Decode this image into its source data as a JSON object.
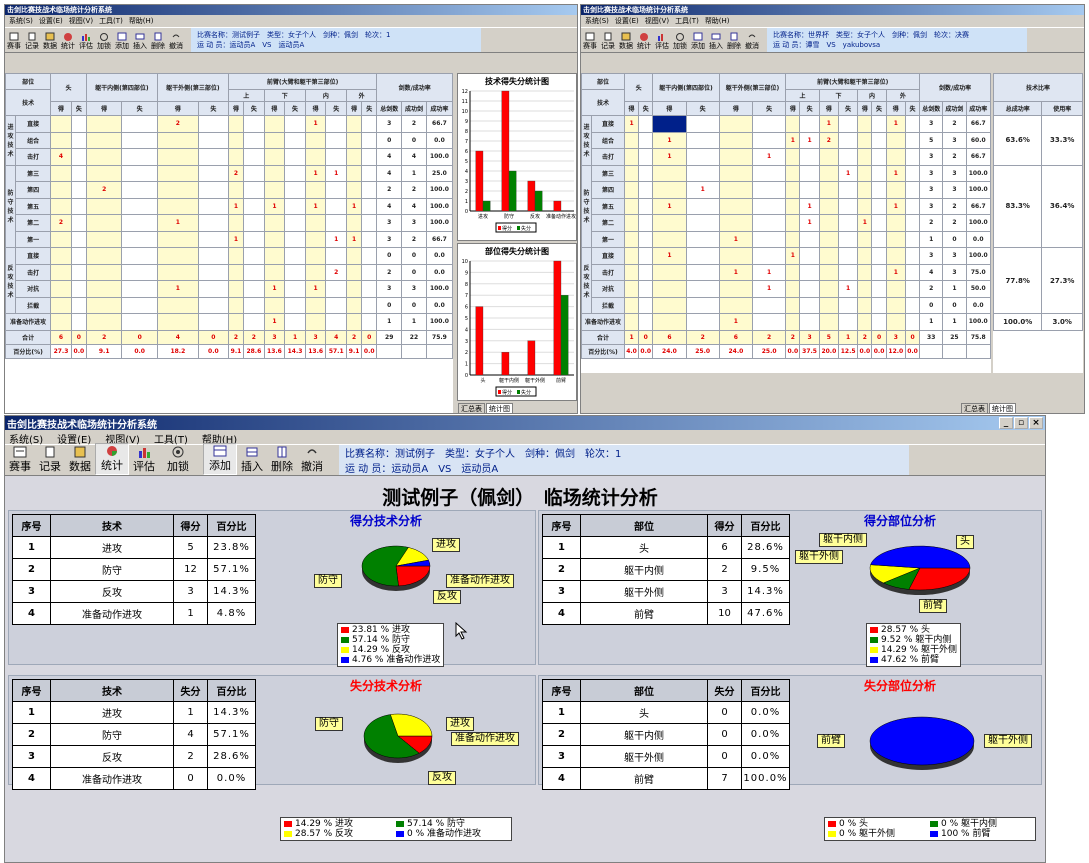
{
  "app_title": "击剑比赛技战术临场统计分析系统",
  "menu": [
    "系统(S)",
    "设置(E)",
    "视图(V)",
    "工具(T)",
    "帮助(H)"
  ],
  "toolbar": [
    "赛事",
    "记录",
    "数据",
    "统计",
    "评估",
    "加锁",
    "添加",
    "插入",
    "删除",
    "撤消"
  ],
  "match": {
    "line1": "比赛名称：测试例子　类型：女子个人　剑种：佩剑　轮次：1",
    "line2": "运 动 员：运动员A　VS　运动员A"
  },
  "right_match": {
    "line1": "比赛名称：世界杯　类型：女子个人　剑种：佩剑　轮次：决赛",
    "line2": "运 动 员：谭雪　VS　yakubovsa"
  },
  "title": "测试例子（佩剑）　临场统计分析",
  "grid_left": {
    "headers": {
      "part": "部位",
      "tech": "技术",
      "head": "头",
      "ti": "躯干内侧(第四部位)",
      "to": "躯干外侧(第三部位)",
      "arm": "前臂(大臂和躯干第三部位)",
      "up": "上",
      "down": "下",
      "in": "内",
      "out": "外",
      "rate": "剑数/成功率",
      "de": "得",
      "shi": "失",
      "total": "总剑数",
      "succ": "成功剑",
      "pct": "成功率"
    },
    "groups": [
      {
        "name": "进攻技术",
        "rows": [
          "直接",
          "组合",
          "击打"
        ]
      },
      {
        "name": "防守技术",
        "rows": [
          "第三",
          "第四",
          "第五",
          "第二",
          "第一"
        ]
      },
      {
        "name": "反攻技术",
        "rows": [
          "直接",
          "击打",
          "对抗",
          "拦截"
        ]
      },
      {
        "name": "",
        "rows": [
          "准备动作进攻"
        ]
      }
    ],
    "cells": [
      [
        "",
        "",
        "",
        "",
        "2",
        "",
        "",
        "",
        "",
        "",
        "1",
        "",
        "",
        "",
        ""
      ],
      [
        "",
        "",
        "",
        "",
        "",
        "",
        "",
        "",
        "",
        "",
        "",
        "",
        "",
        "",
        ""
      ],
      [
        "4",
        "",
        "",
        "",
        "",
        "",
        "",
        "",
        "",
        "",
        "",
        "",
        "",
        "",
        ""
      ],
      [
        "",
        "",
        "",
        "",
        "",
        "",
        "2",
        "",
        "",
        "",
        "1",
        "1",
        "",
        "",
        ""
      ],
      [
        "",
        "",
        "2",
        "",
        "",
        "",
        "",
        "",
        "",
        "",
        "",
        "",
        "",
        "",
        ""
      ],
      [
        "",
        "",
        "",
        "",
        "",
        "",
        "1",
        "",
        "1",
        "",
        "1",
        "",
        "1",
        "",
        ""
      ],
      [
        "2",
        "",
        "",
        "",
        "1",
        "",
        "",
        "",
        "",
        "",
        "",
        "",
        "",
        "",
        ""
      ],
      [
        "",
        "",
        "",
        "",
        "",
        "",
        "1",
        "",
        "",
        "",
        "",
        "1",
        "1",
        "",
        ""
      ],
      [
        "",
        "",
        "",
        "",
        "",
        "",
        "",
        "",
        "",
        "",
        "",
        "",
        "",
        "",
        ""
      ],
      [
        "",
        "",
        "",
        "",
        "",
        "",
        "",
        "",
        "",
        "",
        "",
        "2",
        "",
        "",
        ""
      ],
      [
        "",
        "",
        "",
        "",
        "1",
        "",
        "",
        "",
        "1",
        "",
        "1",
        "",
        "",
        "",
        ""
      ],
      [
        "",
        "",
        "",
        "",
        "",
        "",
        "",
        "",
        "",
        "",
        "",
        "",
        "",
        "",
        ""
      ],
      [
        "",
        "",
        "",
        "",
        "",
        "",
        "",
        "",
        "1",
        "",
        "",
        "",
        "",
        "",
        ""
      ]
    ],
    "rates": [
      [
        "3",
        "2",
        "66.7"
      ],
      [
        "0",
        "0",
        "0.0"
      ],
      [
        "4",
        "4",
        "100.0"
      ],
      [
        "4",
        "1",
        "25.0"
      ],
      [
        "2",
        "2",
        "100.0"
      ],
      [
        "4",
        "4",
        "100.0"
      ],
      [
        "3",
        "3",
        "100.0"
      ],
      [
        "3",
        "2",
        "66.7"
      ],
      [
        "0",
        "0",
        "0.0"
      ],
      [
        "2",
        "0",
        "0.0"
      ],
      [
        "3",
        "3",
        "100.0"
      ],
      [
        "0",
        "0",
        "0.0"
      ],
      [
        "1",
        "1",
        "100.0"
      ]
    ],
    "total_label": "合计",
    "total": [
      "6",
      "0",
      "2",
      "0",
      "4",
      "0",
      "2",
      "2",
      "3",
      "1",
      "3",
      "4",
      "2",
      "0",
      "29",
      "22",
      "75.9"
    ],
    "pct_label": "百分比(%)",
    "pct": [
      "27.3",
      "0.0",
      "9.1",
      "0.0",
      "18.2",
      "0.0",
      "9.1",
      "28.6",
      "13.6",
      "14.3",
      "13.6",
      "57.1",
      "9.1",
      "0.0"
    ],
    "group_last": "准备动作进攻"
  },
  "grid_right": {
    "cells": [
      [
        "1",
        "",
        "",
        "",
        "",
        "",
        "",
        "",
        "1",
        "",
        "",
        "",
        "1",
        ""
      ],
      [
        "",
        "",
        "1",
        "",
        "",
        "",
        "1",
        "1",
        "2",
        "",
        "",
        "",
        "",
        ""
      ],
      [
        "",
        "",
        "1",
        "",
        "",
        "1",
        "",
        "",
        "",
        "",
        "",
        "",
        "",
        ""
      ],
      [
        "",
        "",
        "",
        "",
        "",
        "",
        "",
        "",
        "",
        "1",
        "",
        "",
        "1",
        ""
      ],
      [
        "",
        "",
        "",
        "1",
        "",
        "",
        "",
        "",
        "",
        "",
        "",
        "",
        "",
        ""
      ],
      [
        "",
        "",
        "1",
        "",
        "",
        "",
        "",
        "1",
        "",
        "",
        "",
        "",
        "1",
        ""
      ],
      [
        "",
        "",
        "",
        "",
        "",
        "",
        "",
        "1",
        "",
        "",
        "1",
        "",
        "",
        ""
      ],
      [
        "",
        "",
        "",
        "",
        "1",
        "",
        "",
        "",
        "",
        "",
        "",
        "",
        "",
        ""
      ],
      [
        "",
        "",
        "1",
        "",
        "",
        "",
        "1",
        "",
        "",
        "",
        "",
        "",
        "",
        ""
      ],
      [
        "",
        "",
        "",
        "",
        "1",
        "1",
        "",
        "",
        "",
        "",
        "",
        "",
        "1",
        ""
      ],
      [
        "",
        "",
        "",
        "",
        "",
        "1",
        "",
        "",
        "",
        "1",
        "",
        "",
        "",
        ""
      ],
      [
        "",
        "",
        "",
        "",
        "",
        "",
        "",
        "",
        "",
        "",
        "",
        "",
        "",
        ""
      ],
      [
        "",
        "",
        "",
        "",
        "1",
        "",
        "",
        "",
        "",
        "",
        "",
        "",
        "",
        ""
      ]
    ],
    "rates": [
      [
        "3",
        "2",
        "66.7"
      ],
      [
        "5",
        "3",
        "60.0"
      ],
      [
        "3",
        "2",
        "66.7"
      ],
      [
        "3",
        "3",
        "100.0"
      ],
      [
        "3",
        "3",
        "100.0"
      ],
      [
        "3",
        "2",
        "66.7"
      ],
      [
        "2",
        "2",
        "100.0"
      ],
      [
        "1",
        "0",
        "0.0"
      ],
      [
        "3",
        "3",
        "100.0"
      ],
      [
        "4",
        "3",
        "75.0"
      ],
      [
        "2",
        "1",
        "50.0"
      ],
      [
        "0",
        "0",
        "0.0"
      ],
      [
        "1",
        "1",
        "100.0"
      ]
    ],
    "total": [
      "1",
      "0",
      "6",
      "2",
      "6",
      "2",
      "2",
      "3",
      "5",
      "1",
      "2",
      "0",
      "3",
      "0",
      "33",
      "25",
      "75.8"
    ],
    "pct": [
      "4.0",
      "0.0",
      "24.0",
      "25.0",
      "24.0",
      "25.0",
      "0.0",
      "37.5",
      "20.0",
      "12.5",
      "0.0",
      "0.0",
      "12.0",
      "0.0"
    ],
    "ratio_title": "技术比率",
    "ratio_cols": [
      "总成功率",
      "使用率"
    ],
    "ratios": [
      [
        "63.6%",
        "33.3%"
      ],
      [
        "83.3%",
        "36.4%"
      ],
      [
        "77.8%",
        "27.3%"
      ],
      [
        "100.0%",
        "3.0%"
      ]
    ]
  },
  "top_tabs": [
    "汇总表",
    "统计图"
  ],
  "bar_charts": [
    {
      "title": "技术得失分统计图",
      "categories": [
        "进攻",
        "防守",
        "反攻",
        "准备动作进攻"
      ],
      "series": [
        {
          "name": "得分",
          "values": [
            6,
            12,
            3,
            1
          ]
        },
        {
          "name": "失分",
          "values": [
            1,
            4,
            2,
            0
          ]
        }
      ],
      "legend": [
        "得分",
        "失分"
      ],
      "ymax": 12
    },
    {
      "title": "部位得失分统计图",
      "categories": [
        "头",
        "躯干内侧",
        "躯干外侧",
        "前臂"
      ],
      "series": [
        {
          "name": "得分",
          "values": [
            6,
            2,
            3,
            10
          ]
        },
        {
          "name": "失分",
          "values": [
            0,
            0,
            0,
            7
          ]
        }
      ],
      "legend": [
        "得分",
        "失分"
      ],
      "ymax": 10
    }
  ],
  "tables": {
    "score_tech": {
      "headers": [
        "序号",
        "技术",
        "得分",
        "百分比"
      ],
      "rows": [
        [
          "1",
          "进攻",
          "5",
          "23.8%"
        ],
        [
          "2",
          "防守",
          "12",
          "57.1%"
        ],
        [
          "3",
          "反攻",
          "3",
          "14.3%"
        ],
        [
          "4",
          "准备动作进攻",
          "1",
          "4.8%"
        ]
      ]
    },
    "score_part": {
      "headers": [
        "序号",
        "部位",
        "得分",
        "百分比"
      ],
      "rows": [
        [
          "1",
          "头",
          "6",
          "28.6%"
        ],
        [
          "2",
          "躯干内侧",
          "2",
          "9.5%"
        ],
        [
          "3",
          "躯干外侧",
          "3",
          "14.3%"
        ],
        [
          "4",
          "前臂",
          "10",
          "47.6%"
        ]
      ]
    },
    "loss_tech": {
      "headers": [
        "序号",
        "技术",
        "失分",
        "百分比"
      ],
      "rows": [
        [
          "1",
          "进攻",
          "1",
          "14.3%"
        ],
        [
          "2",
          "防守",
          "4",
          "57.1%"
        ],
        [
          "3",
          "反攻",
          "2",
          "28.6%"
        ],
        [
          "4",
          "准备动作进攻",
          "0",
          "0.0%"
        ]
      ]
    },
    "loss_part": {
      "headers": [
        "序号",
        "部位",
        "失分",
        "百分比"
      ],
      "rows": [
        [
          "1",
          "头",
          "0",
          "0.0%"
        ],
        [
          "2",
          "躯干内侧",
          "0",
          "0.0%"
        ],
        [
          "3",
          "躯干外侧",
          "0",
          "0.0%"
        ],
        [
          "4",
          "前臂",
          "7",
          "100.0%"
        ]
      ]
    }
  },
  "pies": {
    "score_tech": {
      "title": "得分技术分析",
      "labels": [
        "进攻",
        "防守",
        "准备动作进攻",
        "反攻"
      ],
      "legend": [
        "23.81 % 进攻",
        "57.14 % 防守",
        "14.29 % 反攻",
        "4.76 % 准备动作进攻"
      ]
    },
    "score_part": {
      "title": "得分部位分析",
      "labels": [
        "躯干内侧",
        "头",
        "躯干外侧",
        "前臂"
      ],
      "legend": [
        "28.57 % 头",
        "9.52 % 躯干内侧",
        "14.29 % 躯干外侧",
        "47.62 % 前臂"
      ]
    },
    "loss_tech": {
      "title": "失分技术分析",
      "labels": [
        "防守",
        "进攻",
        "准备动作进攻",
        "反攻"
      ],
      "legend": [
        "14.29 % 进攻",
        "57.14 % 防守",
        "28.57 % 反攻",
        "0 % 准备动作进攻"
      ]
    },
    "loss_part": {
      "title": "失分部位分析",
      "labels": [
        "前臂",
        "躯干外侧"
      ],
      "legend": [
        "0 % 头",
        "0 % 躯干内侧",
        "0 % 躯干外侧",
        "100 % 前臂"
      ]
    }
  },
  "chart_data": [
    {
      "type": "bar",
      "title": "技术得失分统计图",
      "categories": [
        "进攻",
        "防守",
        "反攻",
        "准备动作进攻"
      ],
      "series": [
        {
          "name": "得分",
          "values": [
            6,
            12,
            3,
            1
          ]
        },
        {
          "name": "失分",
          "values": [
            1,
            4,
            2,
            0
          ]
        }
      ],
      "ylim": [
        0,
        12
      ]
    },
    {
      "type": "bar",
      "title": "部位得失分统计图",
      "categories": [
        "头",
        "躯干内侧",
        "躯干外侧",
        "前臂"
      ],
      "series": [
        {
          "name": "得分",
          "values": [
            6,
            2,
            3,
            10
          ]
        },
        {
          "name": "失分",
          "values": [
            0,
            0,
            0,
            7
          ]
        }
      ],
      "ylim": [
        0,
        10
      ]
    },
    {
      "type": "pie",
      "title": "得分技术分析",
      "categories": [
        "进攻",
        "防守",
        "反攻",
        "准备动作进攻"
      ],
      "values": [
        23.81,
        57.14,
        14.29,
        4.76
      ]
    },
    {
      "type": "pie",
      "title": "得分部位分析",
      "categories": [
        "头",
        "躯干内侧",
        "躯干外侧",
        "前臂"
      ],
      "values": [
        28.57,
        9.52,
        14.29,
        47.62
      ]
    },
    {
      "type": "pie",
      "title": "失分技术分析",
      "categories": [
        "进攻",
        "防守",
        "反攻",
        "准备动作进攻"
      ],
      "values": [
        14.29,
        57.14,
        28.57,
        0
      ]
    },
    {
      "type": "pie",
      "title": "失分部位分析",
      "categories": [
        "头",
        "躯干内侧",
        "躯干外侧",
        "前臂"
      ],
      "values": [
        0,
        0,
        0,
        100
      ]
    }
  ],
  "colors": {
    "red": "#ff0000",
    "green": "#008000",
    "yellow": "#ffff00",
    "blue": "#0000ff"
  }
}
